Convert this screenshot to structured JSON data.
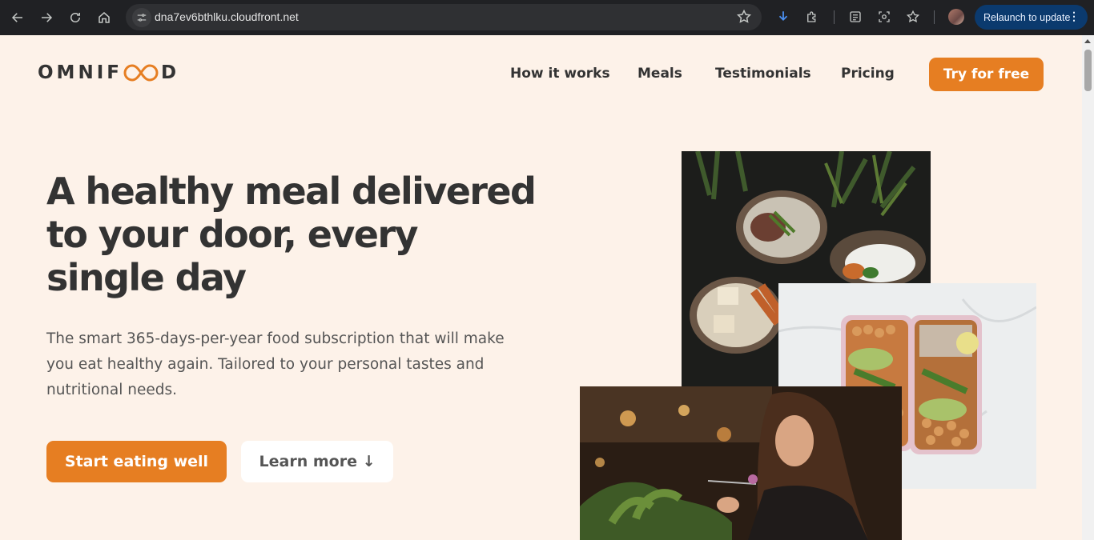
{
  "browser": {
    "url": "dna7ev6bthlku.cloudfront.net",
    "relaunch_label": "Relaunch to update",
    "icons": [
      "back-icon",
      "forward-icon",
      "reload-icon",
      "home-icon",
      "site-settings-icon",
      "bookmark-star-icon",
      "download-icon",
      "extensions-icon",
      "reading-list-icon",
      "screenshot-icon",
      "bookmarks-icon",
      "profile-avatar",
      "menu-dots-icon"
    ]
  },
  "site": {
    "logo": {
      "left": "OMNIF",
      "right": "D"
    },
    "nav": [
      {
        "label": "How it works"
      },
      {
        "label": "Meals"
      },
      {
        "label": "Testimonials"
      },
      {
        "label": "Pricing"
      }
    ],
    "nav_cta": "Try for free",
    "hero": {
      "title": "A healthy meal delivered to your door, every single day",
      "description": "The smart 365-days-per-year food subscription that will make you eat healthy again. Tailored to your personal tastes and nutritional needs.",
      "primary_button": "Start eating well",
      "secondary_button": "Learn more ↓"
    },
    "images": [
      "food bowls photo",
      "meal prep boxes photo",
      "woman eating photo"
    ]
  },
  "colors": {
    "brand": "#e67e22",
    "background": "#fdf2e9",
    "text": "#333333",
    "chrome": "#202124"
  }
}
